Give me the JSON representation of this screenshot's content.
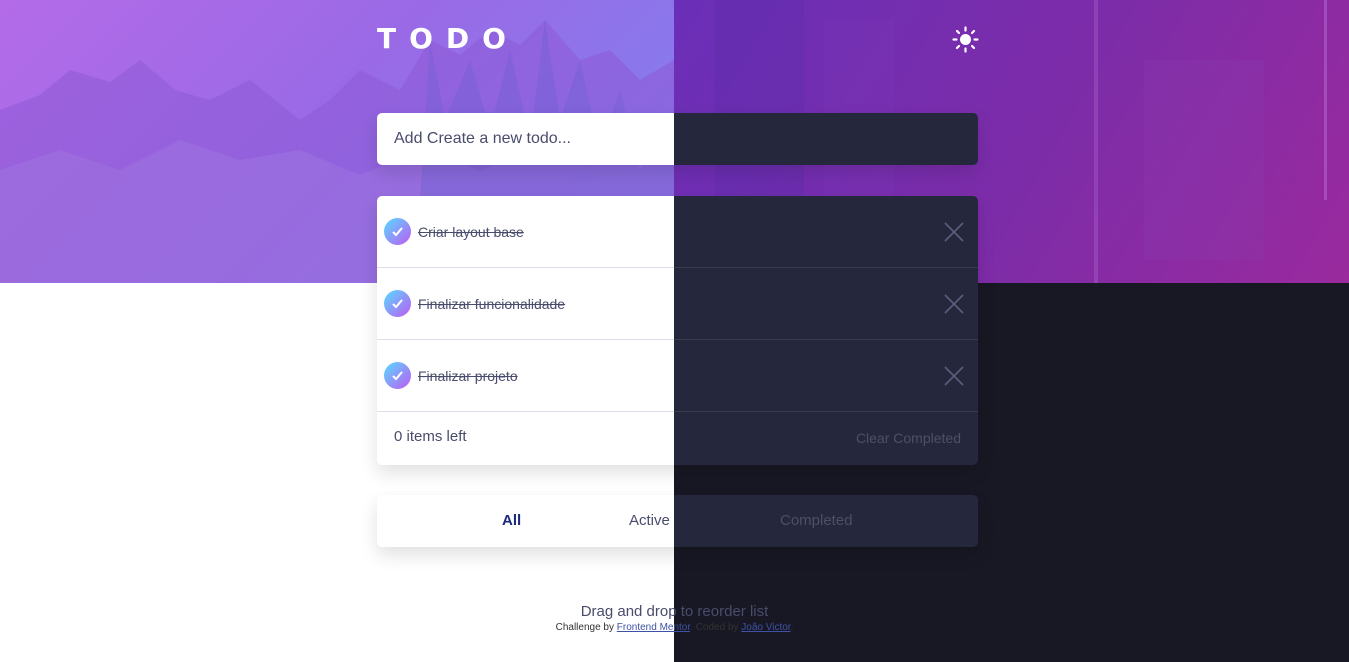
{
  "app": {
    "title": "TODO",
    "theme_toggle_icon": "sun-icon"
  },
  "new_todo": {
    "placeholder": "Add Create a new todo..."
  },
  "todos": [
    {
      "text": "Criar layout base",
      "completed": true
    },
    {
      "text": "Finalizar funcionalidade",
      "completed": true
    },
    {
      "text": "Finalizar projeto",
      "completed": true
    }
  ],
  "footer": {
    "items_left": "0 items left",
    "clear_completed": "Clear Completed"
  },
  "filters": {
    "all": "All",
    "active": "Active",
    "completed": "Completed",
    "selected": "All"
  },
  "hint": "Drag and drop to reorder list",
  "attribution": {
    "prefix": "Challenge by ",
    "challenge_link": "Frontend Mentor",
    "middle": ". Coded by ",
    "author_link": "João Victor",
    "suffix": "."
  },
  "colors": {
    "accent_selected": "#1b2a7a",
    "check_gradient_start": "#55ddff",
    "check_gradient_end": "#c058f3",
    "dark_card": "#25273c",
    "dark_bg": "#181824"
  }
}
